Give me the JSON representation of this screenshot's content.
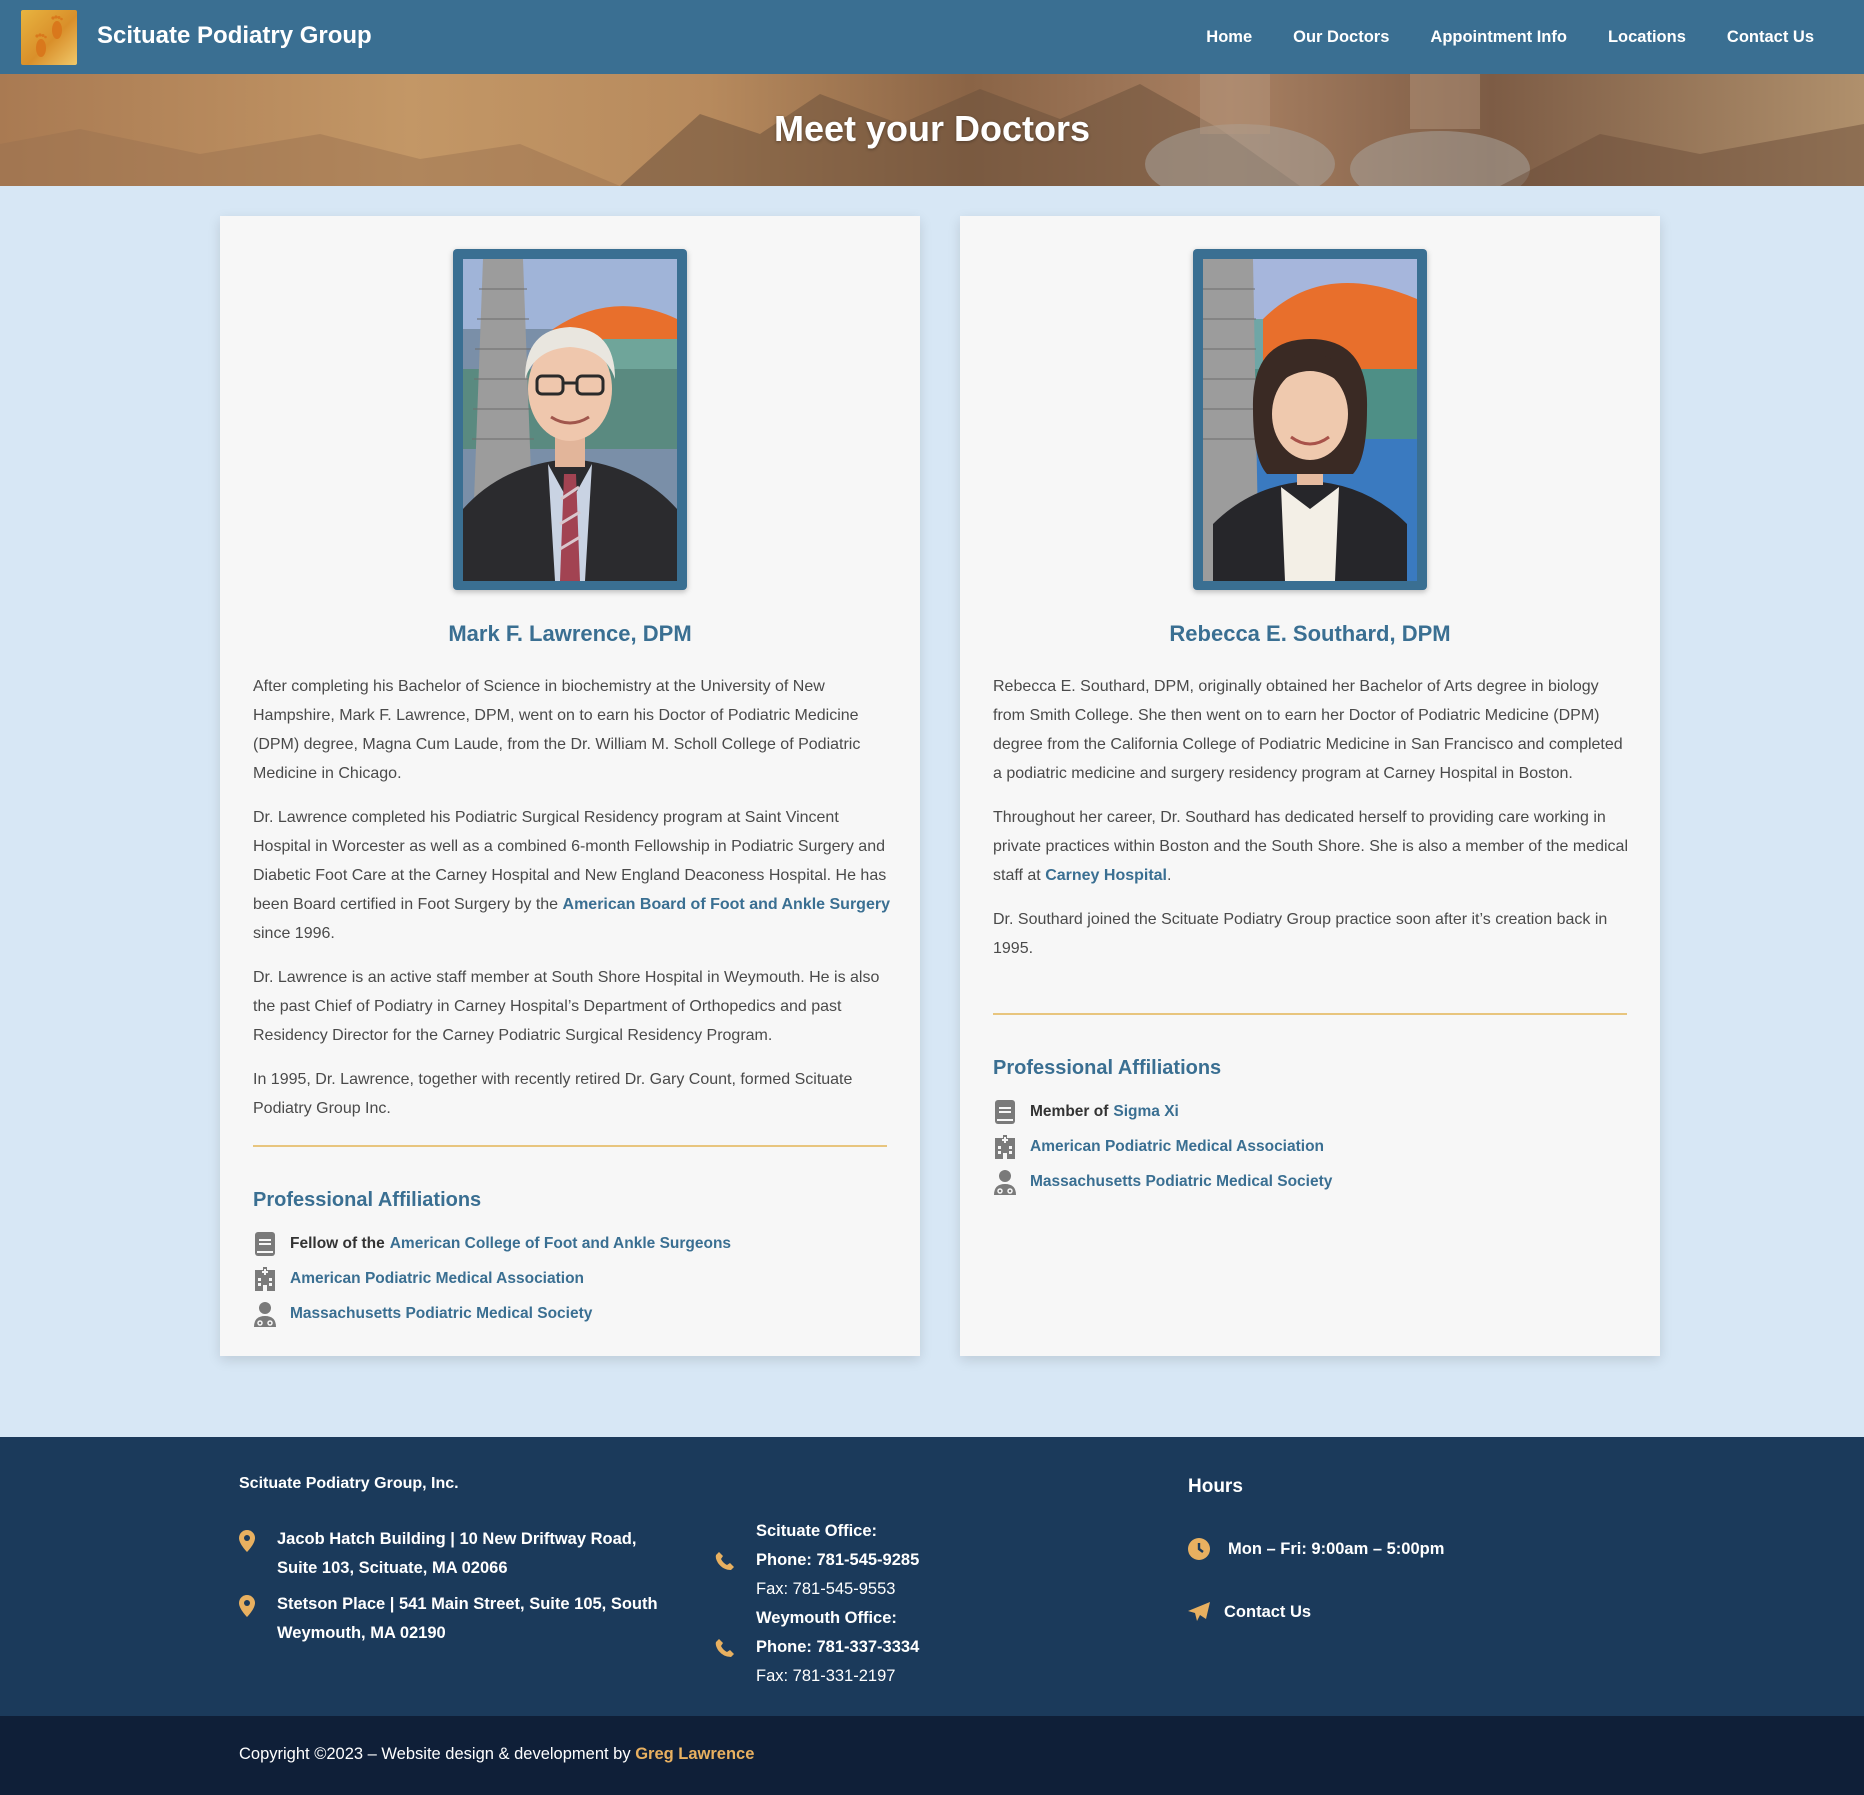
{
  "header": {
    "brand": "Scituate Podiatry Group",
    "nav": [
      "Home",
      "Our Doctors",
      "Appointment Info",
      "Locations",
      "Contact Us"
    ]
  },
  "hero": {
    "title": "Meet your Doctors"
  },
  "doctors": [
    {
      "name": "Mark F. Lawrence, DPM",
      "bio": [
        "After completing his Bachelor of Science in biochemistry at the University of New Hampshire, Mark F. Lawrence, DPM, went on to earn his Doctor of Podiatric Medicine (DPM) degree, Magna Cum Laude, from the Dr. William M. Scholl College of Podiatric Medicine in Chicago.",
        "Dr. Lawrence completed his Podiatric Surgical Residency program at Saint Vincent Hospital in Worcester as well as a combined 6-month Fellowship in Podiatric Surgery and Diabetic Foot Care at the Carney Hospital and New England Deaconess Hospital. He has been Board certified in Foot Surgery by the",
        "American Board of Foot and Ankle Surgery",
        "since 1996.",
        "Dr. Lawrence is an active staff member at South Shore Hospital in Weymouth. He is also the past Chief of Podiatry in Carney Hospital’s Department of Orthopedics and past Residency Director for the Carney Podiatric Surgical Residency Program.",
        "In 1995, Dr. Lawrence, together with recently retired Dr. Gary Count, formed Scituate Podiatry Group Inc."
      ],
      "affiliations_title": "Professional Affiliations",
      "affiliations": [
        {
          "icon": "book-icon",
          "prefix": "Fellow of the",
          "link": "American College of Foot and Ankle Surgeons"
        },
        {
          "icon": "hospital-icon",
          "prefix": "",
          "link": "American Podiatric Medical Association"
        },
        {
          "icon": "doctor-icon",
          "prefix": "",
          "link": "Massachusetts Podiatric Medical Society"
        }
      ]
    },
    {
      "name": "Rebecca E. Southard, DPM",
      "bio": [
        "Rebecca E. Southard, DPM, originally obtained her Bachelor of Arts degree in biology from Smith College. She then went on to earn her Doctor of Podiatric Medicine (DPM) degree from the California College of Podiatric Medicine in San Francisco and completed a podiatric medicine and surgery residency program at Carney Hospital in Boston.",
        "Throughout her career, Dr. Southard has dedicated herself to providing care working in private practices within Boston and the South Shore. She is also a member of the medical staff at",
        "Carney Hospital",
        ".",
        "Dr. Southard joined the Scituate Podiatry Group practice soon after it’s creation back in 1995."
      ],
      "affiliations_title": "Professional Affiliations",
      "affiliations": [
        {
          "icon": "book-icon",
          "prefix": "Member of",
          "link": "Sigma Xi"
        },
        {
          "icon": "hospital-icon",
          "prefix": "",
          "link": "American Podiatric Medical Association"
        },
        {
          "icon": "doctor-icon",
          "prefix": "",
          "link": "Massachusetts Podiatric Medical Society"
        }
      ]
    }
  ],
  "footer": {
    "company": "Scituate Podiatry Group, Inc.",
    "addresses": [
      "Jacob Hatch Building | 10 New Driftway Road, Suite 103, Scituate, MA 02066",
      "Stetson Place | 541 Main Street, Suite 105, South Weymouth, MA 02190"
    ],
    "offices": [
      {
        "label": "Scituate Office:",
        "phone": "Phone: 781-545-9285",
        "fax": "Fax: 781-545-9553"
      },
      {
        "label": "Weymouth Office:",
        "phone": "Phone: 781-337-3334",
        "fax": "Fax: 781-331-2197"
      }
    ],
    "hours_title": "Hours",
    "hours": "Mon – Fri: 9:00am – 5:00pm",
    "contact": "Contact Us"
  },
  "copyright": {
    "text": "Copyright ©2023 – Website design & development by",
    "author": "Greg Lawrence"
  },
  "colors": {
    "primary": "#3a6f92",
    "accent": "#e8b060",
    "footer": "#1b3a5b",
    "page_bg": "#d7e7f5"
  }
}
